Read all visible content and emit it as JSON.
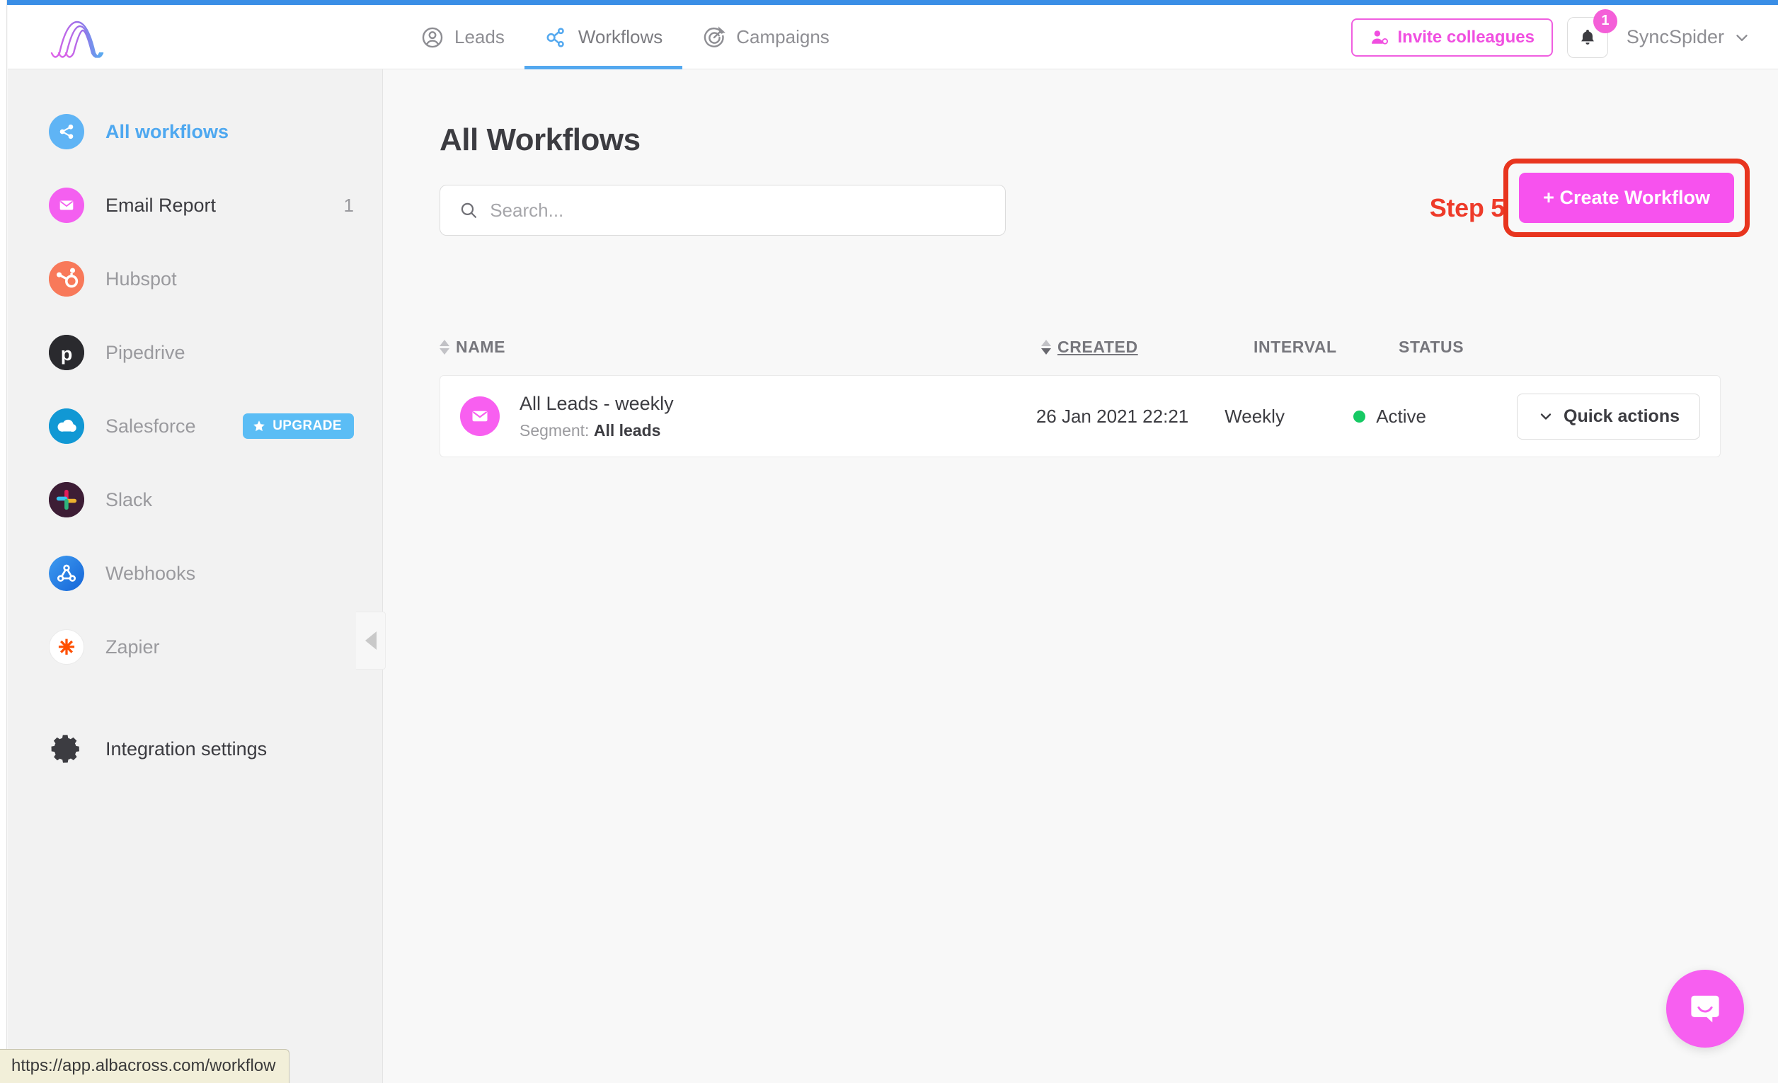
{
  "browser": {
    "status_url": "https://app.albacross.com/workflow"
  },
  "header": {
    "logo_name": "albacross-logo",
    "nav": [
      {
        "label": "Leads",
        "icon": "user-circle-icon",
        "active": false
      },
      {
        "label": "Workflows",
        "icon": "workflow-share-icon",
        "active": true
      },
      {
        "label": "Campaigns",
        "icon": "target-campaign-icon",
        "active": false
      }
    ],
    "invite_label": "Invite colleagues",
    "notification_count": "1",
    "account_name": "SyncSpider"
  },
  "sidebar": {
    "items": [
      {
        "label": "All workflows",
        "icon": "share-icon",
        "state": "active",
        "badge": ""
      },
      {
        "label": "Email Report",
        "icon": "envelope-icon",
        "state": "dark",
        "badge": "1"
      },
      {
        "label": "Hubspot",
        "icon": "hubspot-icon",
        "state": "muted",
        "badge": ""
      },
      {
        "label": "Pipedrive",
        "icon": "pipedrive-icon",
        "state": "muted",
        "badge": ""
      },
      {
        "label": "Salesforce",
        "icon": "salesforce-icon",
        "state": "muted",
        "badge": "",
        "upgrade": "UPGRADE"
      },
      {
        "label": "Slack",
        "icon": "slack-icon",
        "state": "muted",
        "badge": ""
      },
      {
        "label": "Webhooks",
        "icon": "webhooks-icon",
        "state": "muted",
        "badge": ""
      },
      {
        "label": "Zapier",
        "icon": "zapier-icon",
        "state": "muted",
        "badge": ""
      }
    ],
    "settings_label": "Integration settings"
  },
  "main": {
    "title": "All Workflows",
    "search_placeholder": "Search...",
    "search_value": "",
    "step_annotation": "Step 5",
    "create_button": "+ Create Workflow",
    "columns": {
      "name": "NAME",
      "created": "CREATED",
      "interval": "INTERVAL",
      "status": "STATUS"
    },
    "rows": [
      {
        "name": "All Leads - weekly",
        "segment_label": "Segment:",
        "segment_value": "All leads",
        "created": "26 Jan 2021 22:21",
        "interval": "Weekly",
        "status": "Active",
        "action_label": "Quick actions"
      }
    ]
  },
  "chat": {
    "icon": "intercom-chat-icon"
  },
  "colors": {
    "accent_blue": "#53a8ef",
    "accent_pink": "#f752ee",
    "annotation_red": "#e8351f",
    "status_green": "#16c964",
    "upgrade_blue": "#5bbdf5"
  }
}
